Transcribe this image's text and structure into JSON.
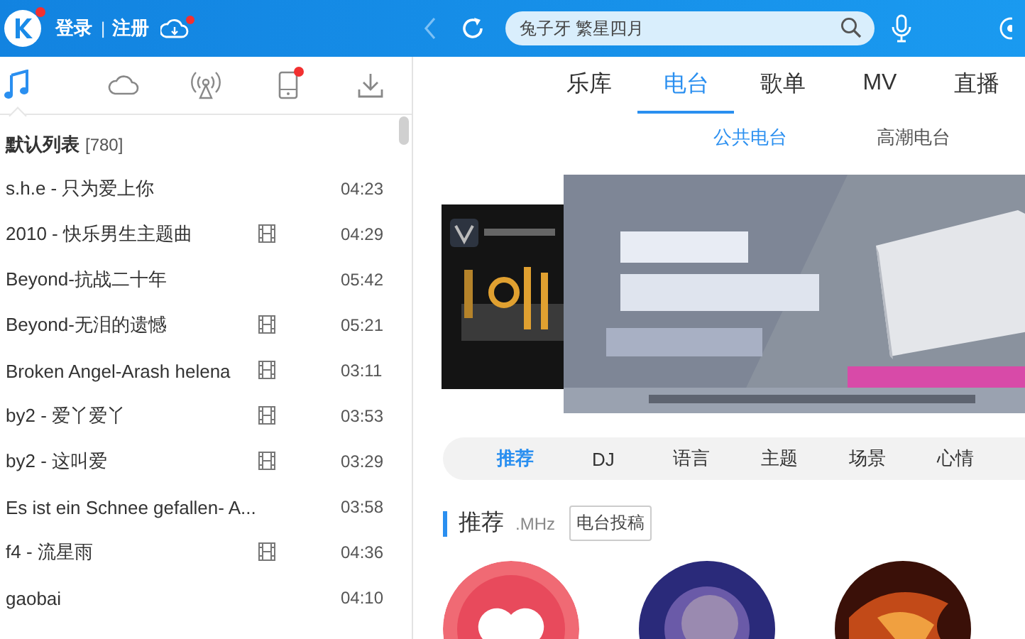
{
  "top_bar": {
    "login": "登录",
    "separator": "|",
    "register": "注册",
    "logo_badge": true,
    "cloud_badge": true,
    "search": {
      "placeholder": "兔子牙 繁星四月"
    }
  },
  "left_tabs": [
    {
      "kind": "music",
      "selected": true,
      "badge": false
    },
    {
      "kind": "cloud",
      "selected": false,
      "badge": false
    },
    {
      "kind": "radio",
      "selected": false,
      "badge": false
    },
    {
      "kind": "phone",
      "selected": false,
      "badge": true
    },
    {
      "kind": "download",
      "selected": false,
      "badge": false
    }
  ],
  "playlist": {
    "title": "默认列表",
    "count": "[780]",
    "songs": [
      {
        "title": "s.h.e - 只为爱上你",
        "mv": false,
        "duration": "04:23"
      },
      {
        "title": "2010 - 快乐男生主题曲",
        "mv": true,
        "duration": "04:29"
      },
      {
        "title": "Beyond-抗战二十年",
        "mv": false,
        "duration": "05:42"
      },
      {
        "title": "Beyond-无泪的遗憾",
        "mv": true,
        "duration": "05:21"
      },
      {
        "title": "Broken Angel-Arash helena",
        "mv": true,
        "duration": "03:11"
      },
      {
        "title": "by2 - 爱丫爱丫",
        "mv": true,
        "duration": "03:53"
      },
      {
        "title": "by2 - 这叫爱",
        "mv": true,
        "duration": "03:29"
      },
      {
        "title": "Es ist ein Schnee gefallen- A...",
        "mv": false,
        "duration": "03:58"
      },
      {
        "title": "f4 - 流星雨",
        "mv": true,
        "duration": "04:36"
      },
      {
        "title": "gaobai",
        "mv": false,
        "duration": "04:10"
      }
    ]
  },
  "nav_tabs": [
    {
      "label": "乐库",
      "selected": false
    },
    {
      "label": "电台",
      "selected": true
    },
    {
      "label": "歌单",
      "selected": false
    },
    {
      "label": "MV",
      "selected": false
    },
    {
      "label": "直播",
      "selected": false
    }
  ],
  "sub_tabs": [
    {
      "label": "公共电台",
      "selected": true
    },
    {
      "label": "高潮电台",
      "selected": false
    }
  ],
  "category_tabs": [
    {
      "label": "推荐",
      "selected": true
    },
    {
      "label": "DJ",
      "selected": false
    },
    {
      "label": "语言",
      "selected": false
    },
    {
      "label": "主题",
      "selected": false
    },
    {
      "label": "场景",
      "selected": false
    },
    {
      "label": "心情",
      "selected": false
    }
  ],
  "section": {
    "title": "推荐",
    "subtitle": ".MHz",
    "button": "电台投稿"
  },
  "stations": [
    {
      "kind": "heart"
    },
    {
      "kind": "picture"
    },
    {
      "kind": "picture"
    }
  ]
}
